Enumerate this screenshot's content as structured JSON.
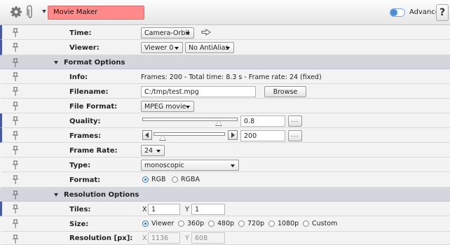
{
  "header": {
    "node_name": "Movie Maker",
    "advanced_label": "Advanced",
    "advanced_on": true,
    "help_label": "?"
  },
  "params": {
    "time": {
      "label": "Time:",
      "value": "Camera-Orbit"
    },
    "viewer": {
      "label": "Viewer:",
      "viewer_value": "Viewer 0",
      "aa_value": "No AntiAlias"
    }
  },
  "format_section": {
    "title": "Format Options",
    "info": {
      "label": "Info:",
      "value": "Frames: 200 - Total time: 8.3 s - Frame rate: 24 (fixed)"
    },
    "filename": {
      "label": "Filename:",
      "value": "C:/tmp/test.mpg",
      "browse_label": "Browse"
    },
    "file_format": {
      "label": "File Format:",
      "value": "MPEG movie"
    },
    "quality": {
      "label": "Quality:",
      "value": "0.8",
      "slider_fraction": 0.8,
      "ellipsis": "..."
    },
    "frames": {
      "label": "Frames:",
      "value": "200",
      "ellipsis": "..."
    },
    "frame_rate": {
      "label": "Frame Rate:",
      "value": "24"
    },
    "type": {
      "label": "Type:",
      "value": "monoscopic"
    },
    "format": {
      "label": "Format:",
      "options": [
        "RGB",
        "RGBA"
      ],
      "selected": "RGB"
    }
  },
  "resolution_section": {
    "title": "Resolution Options",
    "tiles": {
      "label": "Tiles:",
      "x_label": "X",
      "x_value": "1",
      "y_label": "Y",
      "y_value": "1"
    },
    "size": {
      "label": "Size:",
      "options": [
        "Viewer",
        "360p",
        "480p",
        "720p",
        "1080p",
        "Custom"
      ],
      "selected": "Viewer"
    },
    "resolution": {
      "label": "Resolution [px]:",
      "x_label": "X",
      "x_value": "1136",
      "y_label": "Y",
      "y_value": "608"
    }
  },
  "colors": {
    "name_field": "#ff8a8a",
    "row_accent": "#4a5a9b",
    "section_bg": "#d4d6dd",
    "radio_selected": "#2a6fc7"
  }
}
